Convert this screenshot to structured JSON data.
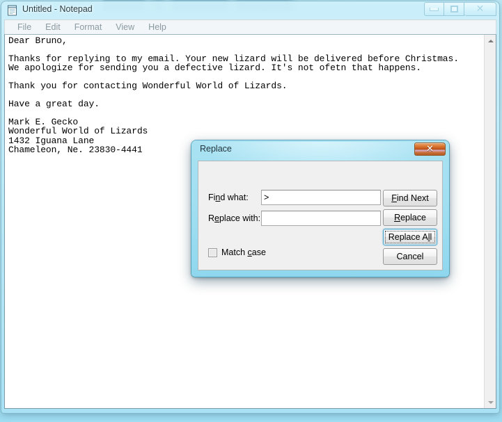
{
  "window": {
    "title": "Untitled - Notepad",
    "icon": "notepad-icon",
    "controls": {
      "minimize": "minimize-icon",
      "maximize": "maximize-icon",
      "close": "close-icon"
    }
  },
  "menu": {
    "items": [
      {
        "label": "File"
      },
      {
        "label": "Edit"
      },
      {
        "label": "Format"
      },
      {
        "label": "View"
      },
      {
        "label": "Help"
      }
    ]
  },
  "editor": {
    "content": "Dear Bruno,\n\nThanks for replying to my email. Your new lizard will be delivered before Christmas.\nWe apologize for sending you a defective lizard. It's not ofetn that happens.\n\nThank you for contacting Wonderful World of Lizards.\n\nHave a great day.\n\nMark E. Gecko\nWonderful World of Lizards\n1432 Iguana Lane\nChameleon, Ne. 23830-4441",
    "scrollbar": {
      "up_arrow": "scroll-up-icon",
      "down_arrow": "scroll-down-icon"
    }
  },
  "dialog": {
    "title": "Replace",
    "close_icon": "close-icon",
    "find_what": {
      "label": "Find what:",
      "label_prefix": "Fi",
      "label_accel": "n",
      "label_suffix": "d what:",
      "value": ">",
      "placeholder": ""
    },
    "replace_with": {
      "label": "Replace with:",
      "label_prefix": "R",
      "label_accel": "e",
      "label_suffix": "place with:",
      "value": "",
      "placeholder": ""
    },
    "buttons": [
      {
        "id": "find-next",
        "prefix": "",
        "accel": "F",
        "suffix": "ind Next",
        "focused": false
      },
      {
        "id": "replace",
        "prefix": "",
        "accel": "R",
        "suffix": "eplace",
        "focused": false
      },
      {
        "id": "replace-all",
        "prefix": "Replace A",
        "accel": "l",
        "suffix": "l",
        "focused": true
      },
      {
        "id": "cancel",
        "prefix": "Cancel",
        "accel": "",
        "suffix": "",
        "focused": false
      }
    ],
    "match_case": {
      "label_prefix": "Match ",
      "label_accel": "c",
      "label_suffix": "ase",
      "checked": false
    }
  },
  "colors": {
    "dialog_accent": "#9fdef1",
    "close_button": "#c4571c",
    "focus_outline": "#5aa8cc",
    "desktop": "#bfe9f6"
  }
}
